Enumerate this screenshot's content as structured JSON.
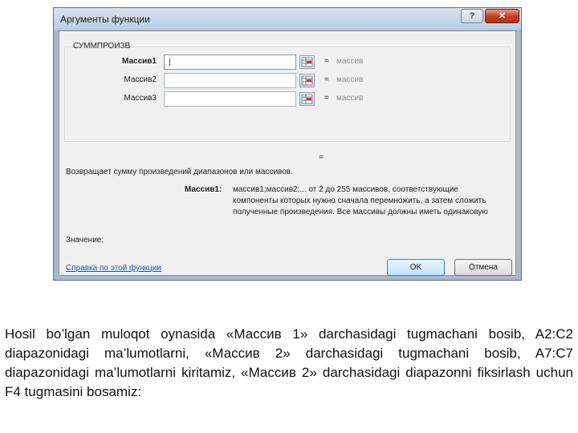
{
  "dialog": {
    "title": "Аргументы функции",
    "help_label": "?",
    "close_label": "✕",
    "function_name": "СУММПРОИЗВ",
    "arguments": [
      {
        "label": "Массив1",
        "value": "|",
        "result": "массив",
        "active": true
      },
      {
        "label": "Массив2",
        "value": "",
        "result": "массив",
        "active": false
      },
      {
        "label": "Массив3",
        "value": "",
        "result": "массив",
        "active": false
      }
    ],
    "equals_sign": "=",
    "formula_equals": "=",
    "description": "Возвращает сумму произведений диапазонов или массивов.",
    "arg_help_label": "Массив1:",
    "arg_help_lines": [
      "массив1;массив2;... от 2 до 255 массивов, соответствующие",
      "компоненты которых нужно сначала перемножить, а затем сложить",
      "полученные произведения. Все массивы должны иметь одинаковую"
    ],
    "value_label": "Значение:",
    "help_link": "Справка по этой функции",
    "ok_label": "OK",
    "cancel_label": "Отмена",
    "icons": {
      "help": "question-icon",
      "close": "close-icon",
      "collapse": "range-select-icon"
    }
  },
  "caption": "Hosil bo’lgan muloqot oynasida «Массив 1» darchasidagi tugmachani bosib,   A2:C2 diapazonidagi ma’lumotlarni, «Массив 2» darchasidagi tugmachani bosib, A7:C7 diapazonidagi ma’lumotlarni kiritamiz, «Массив 2» darchasidagi  diapazonni fiksirlash uchun F4 tugmasini bosamiz:"
}
